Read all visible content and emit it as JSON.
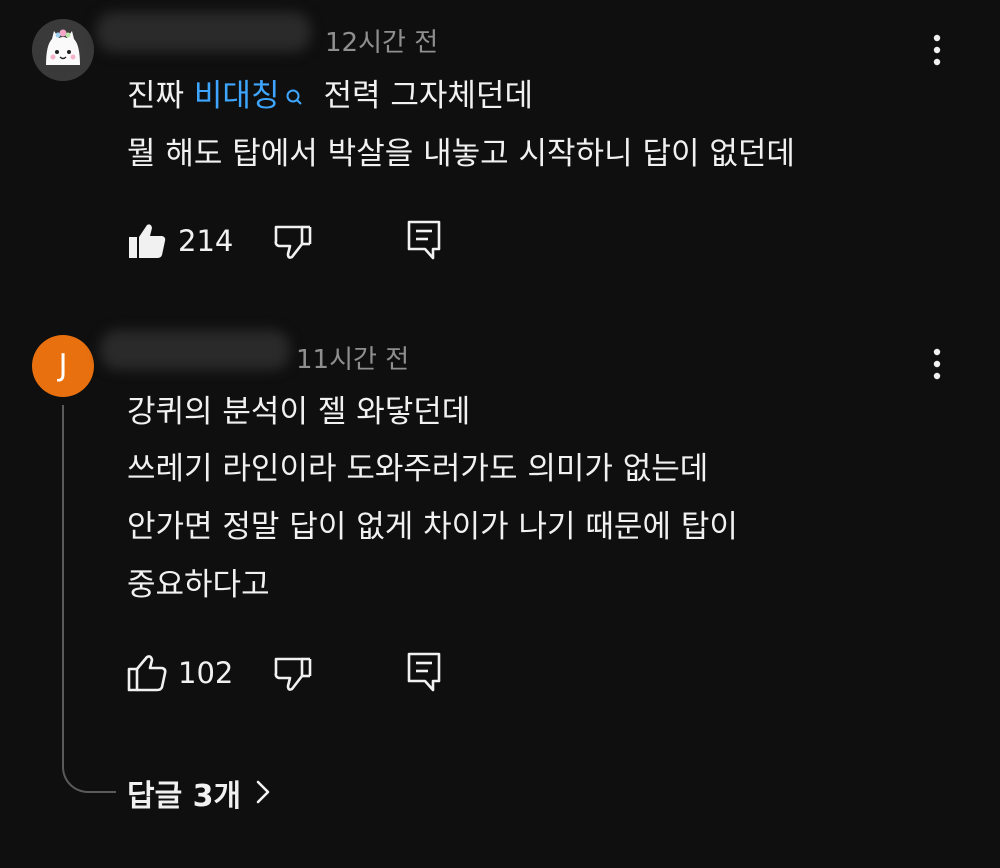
{
  "comments": [
    {
      "timestamp": "12시간 전",
      "body_line1_prefix": "진짜 ",
      "body_line1_hashtag": "비대칭",
      "body_line1_suffix": "전력 그자체던데",
      "body_line2": "뭘 해도 탑에서 박살을 내놓고 시작하니 답이 없던데",
      "likes": "214",
      "liked": true,
      "avatar_icon": "cat-avatar-icon"
    },
    {
      "timestamp": "11시간 전",
      "avatar_letter": "J",
      "avatar_color": "#e8700f",
      "body_lines": [
        "강퀴의 분석이 젤 와닿던데",
        "쓰레기 라인이라 도와주러가도 의미가 없는데",
        "안가면 정말 답이 없게 차이가 나기 때문에 탑이",
        "중요하다고"
      ],
      "likes": "102",
      "liked": false,
      "replies_label": "답글 3개"
    }
  ],
  "colors": {
    "background": "#0f0f0f",
    "text": "#f1f1f1",
    "secondary_text": "#8f8f8f",
    "hashtag": "#3ea6ff"
  }
}
